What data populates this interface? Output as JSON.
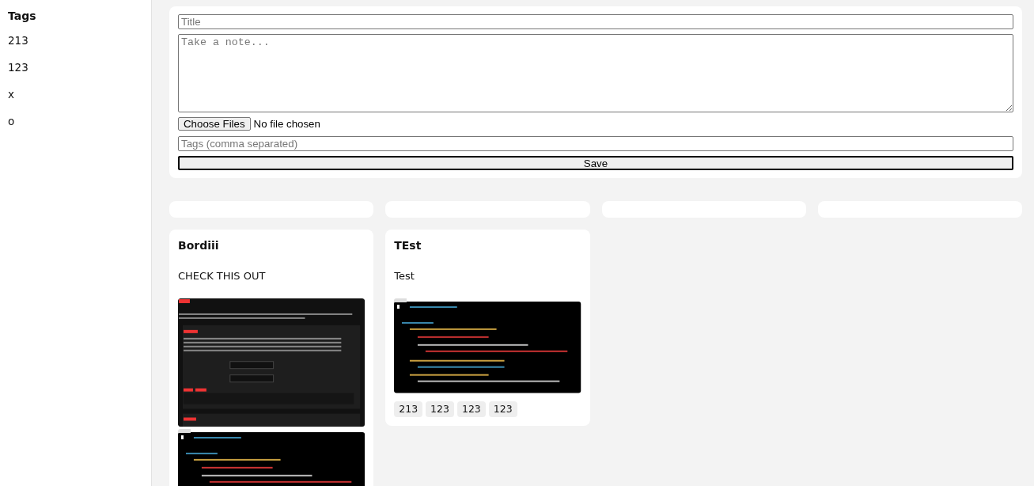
{
  "sidebar": {
    "heading": "Tags",
    "items": [
      {
        "label": "213"
      },
      {
        "label": "123"
      },
      {
        "label": "x"
      },
      {
        "label": "o"
      }
    ]
  },
  "form": {
    "title_placeholder": "Title",
    "note_placeholder": "Take a note...",
    "file_button": "Choose Files",
    "file_status": "No file chosen",
    "tags_placeholder": "Tags (comma separated)",
    "save_button": "Save"
  },
  "notes": [
    {
      "kind": "empty"
    },
    {
      "kind": "empty"
    },
    {
      "kind": "empty"
    },
    {
      "kind": "empty"
    },
    {
      "kind": "note",
      "title": "Bordiii",
      "content": "CHECK THIS OUT",
      "attachments": [
        {
          "kind": "docs-page"
        },
        {
          "kind": "code-editor"
        }
      ]
    },
    {
      "kind": "note",
      "title": "TEst",
      "content": "Test",
      "attachments": [
        {
          "kind": "code-editor"
        }
      ],
      "tags": [
        "213",
        "123",
        "123",
        "123"
      ]
    }
  ]
}
